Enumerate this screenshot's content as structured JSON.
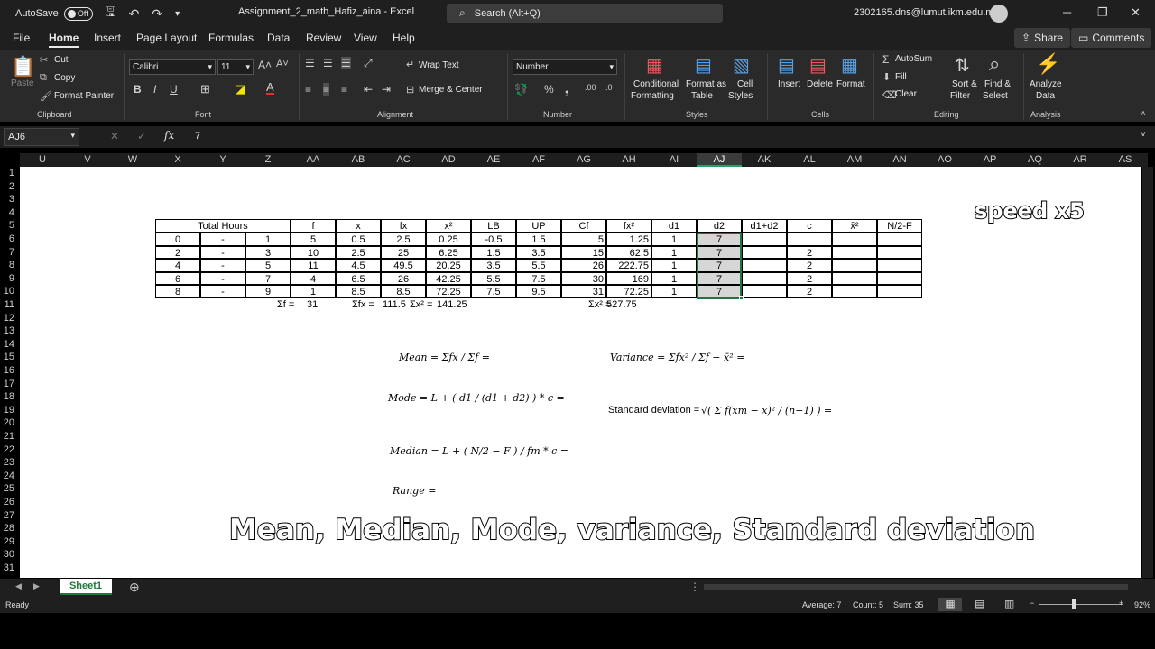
{
  "titlebar": {
    "autosave_label": "AutoSave",
    "autosave_state": "Off",
    "doc_title": "Assignment_2_math_Hafiz_aina  -  Excel",
    "search_placeholder": "Search (Alt+Q)",
    "user_email": "2302165.dns@lumut.ikm.edu.my"
  },
  "menu": {
    "tabs": [
      "File",
      "Home",
      "Insert",
      "Page Layout",
      "Formulas",
      "Data",
      "Review",
      "View",
      "Help"
    ],
    "active": "Home",
    "share": "Share",
    "comments": "Comments"
  },
  "ribbon": {
    "clipboard": {
      "label": "Clipboard",
      "paste": "Paste",
      "cut": "Cut",
      "copy": "Copy",
      "format_painter": "Format Painter"
    },
    "font": {
      "label": "Font",
      "family": "Calibri",
      "size": "11"
    },
    "alignment": {
      "label": "Alignment",
      "wrap": "Wrap Text",
      "merge": "Merge & Center"
    },
    "number": {
      "label": "Number",
      "format": "Number"
    },
    "styles": {
      "label": "Styles",
      "conditional": [
        "Conditional",
        "Formatting"
      ],
      "format_table": [
        "Format as",
        "Table"
      ],
      "cell_styles": [
        "Cell",
        "Styles"
      ]
    },
    "cells": {
      "label": "Cells",
      "insert": "Insert",
      "delete": "Delete",
      "format": "Format"
    },
    "editing": {
      "label": "Editing",
      "autosum": "AutoSum",
      "fill": "Fill",
      "clear": "Clear",
      "sort": [
        "Sort &",
        "Filter"
      ],
      "find": [
        "Find &",
        "Select"
      ]
    },
    "analysis": {
      "label": "Analysis",
      "analyze": [
        "Analyze",
        "Data"
      ]
    }
  },
  "formula_bar": {
    "name_box": "AJ6",
    "value": "7"
  },
  "columns": [
    "U",
    "V",
    "W",
    "X",
    "Y",
    "Z",
    "AA",
    "AB",
    "AC",
    "AD",
    "AE",
    "AF",
    "AG",
    "AH",
    "AI",
    "AJ",
    "AK",
    "AL",
    "AM",
    "AN",
    "AO",
    "AP",
    "AQ",
    "AR",
    "AS"
  ],
  "rows": [
    "1",
    "2",
    "3",
    "4",
    "5",
    "6",
    "7",
    "8",
    "9",
    "10",
    "11",
    "12",
    "13",
    "14",
    "15",
    "16",
    "17",
    "18",
    "19",
    "20",
    "21",
    "22",
    "23",
    "24",
    "25",
    "26",
    "27",
    "28",
    "29",
    "30",
    "31"
  ],
  "table": {
    "headers": [
      "Total Hours",
      "f",
      "x",
      "fx",
      "x²",
      "LB",
      "UP",
      "Cf",
      "fx²",
      "d1",
      "d2",
      "d1+d2",
      "c",
      "x̄²",
      "N/2-F"
    ],
    "rows": [
      [
        "0",
        "-",
        "1",
        "5",
        "0.5",
        "2.5",
        "0.25",
        "-0.5",
        "1.5",
        "5",
        "1.25",
        "1",
        "7",
        "",
        ""
      ],
      [
        "2",
        "-",
        "3",
        "10",
        "2.5",
        "25",
        "6.25",
        "1.5",
        "3.5",
        "15",
        "62.5",
        "1",
        "7",
        "",
        "2"
      ],
      [
        "4",
        "-",
        "5",
        "11",
        "4.5",
        "49.5",
        "20.25",
        "3.5",
        "5.5",
        "26",
        "222.75",
        "1",
        "7",
        "",
        "2"
      ],
      [
        "6",
        "-",
        "7",
        "4",
        "6.5",
        "26",
        "42.25",
        "5.5",
        "7.5",
        "30",
        "169",
        "1",
        "7",
        "",
        "2"
      ],
      [
        "8",
        "-",
        "9",
        "1",
        "8.5",
        "8.5",
        "72.25",
        "7.5",
        "9.5",
        "31",
        "72.25",
        "1",
        "7",
        "",
        "2"
      ]
    ],
    "sum_f_label": "Σf =",
    "sum_f": "31",
    "sum_fx_label": "Σfx =",
    "sum_fx": "111.5",
    "sum_x2_label": "Σx² =",
    "sum_x2": "141.25",
    "sum_fx2_label": "Σx² =",
    "sum_fx2": "527.75"
  },
  "formulas": {
    "mean": "Mean = Σfx / Σf =",
    "mode": "Mode = L + ( d1 / (d1 + d2) ) * c =",
    "median": "Median = L + ( N/2 − F ) / fm * c =",
    "range": "Range =",
    "variance": "Variance = Σfx² / Σf − x̄² =",
    "std_label": "Standard deviation =",
    "std_formula": "√( Σ f(xm − x)² / (n−1) ) ="
  },
  "overlay": {
    "speed": "speed x5",
    "caption": "Mean, Median, Mode, variance, Standard deviation"
  },
  "sheet_tab": "Sheet1",
  "status": {
    "ready": "Ready",
    "average": "Average: 7",
    "count": "Count: 5",
    "sum": "Sum: 35",
    "zoom": "92%"
  }
}
